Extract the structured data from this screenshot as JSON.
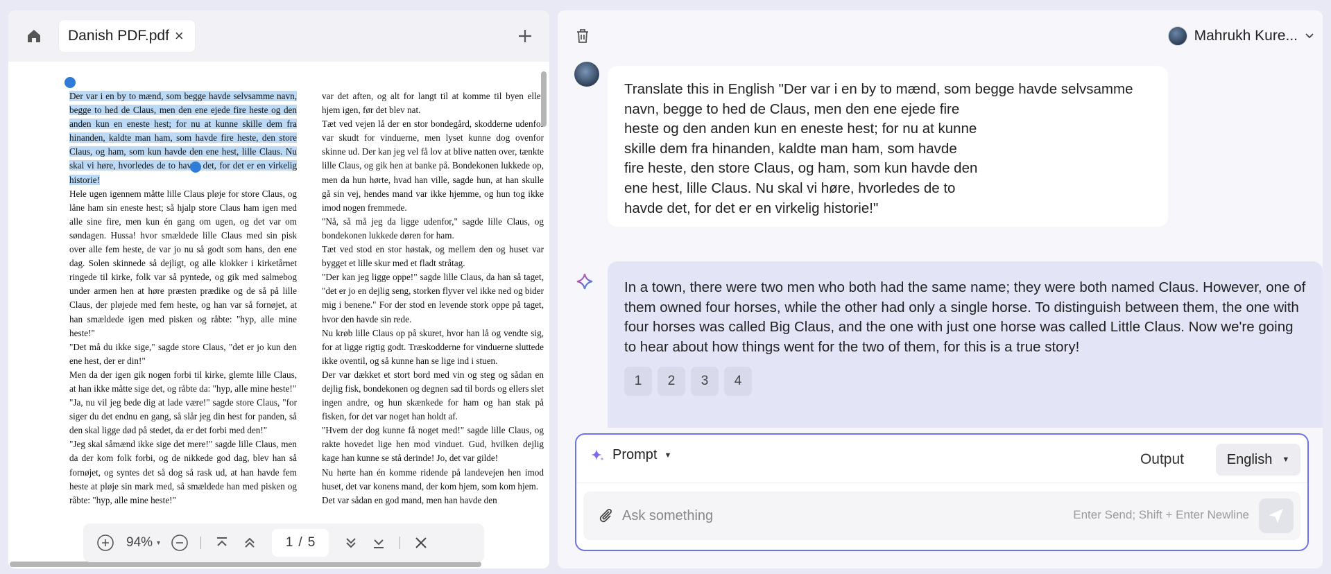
{
  "left_pane": {
    "tab": {
      "label": "Danish PDF.pdf",
      "close_glyph": "×"
    },
    "icons": {
      "home": "home-icon",
      "add": "plus-icon"
    },
    "pdf": {
      "left_column": [
        {
          "text": "Der var i en by to mænd, som begge havde selvsamme navn, begge to hed de Claus, men den ene ejede fire heste og den anden kun en eneste hest; for nu at kunne skille dem fra hinanden, kaldte man ham, som havde fire heste, den store Claus, og ham, som kun havde den ene hest, lille Claus. Nu skal vi høre, hvorledes de to havde det, for det er en virkelig historie!",
          "highlighted": true
        },
        {
          "text": "Hele ugen igennem måtte lille Claus pløje for store Claus, og låne ham sin eneste hest; så hjalp store Claus ham igen med alle sine fire, men kun én gang om ugen, og det var om søndagen. Hussa! hvor smældede lille Claus med sin pisk over alle fem heste, de var jo nu så godt som hans, den ene dag. Solen skinnede så dejligt, og alle klokker i kirketårnet ringede til kirke, folk var så pyntede, og gik med salmebog under armen hen at høre præsten prædike og de så på lille Claus, der pløjede med fem heste, og han var så fornøjet, at han smældede igen med pisken og råbte: \"hyp, alle mine heste!\"",
          "highlighted": false
        },
        {
          "text": "\"Det må du ikke sige,\" sagde store Claus, \"det er jo kun den ene hest, der er din!\"",
          "highlighted": false
        },
        {
          "text": "Men da der igen gik nogen forbi til kirke, glemte lille Claus, at han ikke måtte sige det, og råbte da: \"hyp, alle mine heste!\"",
          "highlighted": false
        },
        {
          "text": "\"Ja, nu vil jeg bede dig at lade være!\" sagde store Claus, \"for siger du det endnu en gang, så slår jeg din hest for panden, så den skal ligge død på stedet, da er det forbi med den!\"",
          "highlighted": false
        },
        {
          "text": "\"Jeg skal såmænd ikke sige det mere!\" sagde lille Claus, men da der kom folk forbi, og de nikkede god dag, blev han så fornøjet, og syntes det så dog så rask ud, at han havde fem heste at pløje sin mark med, så smældede han med pisken og råbte: \"hyp, alle mine heste!\"",
          "highlighted": false
        }
      ],
      "right_column": [
        "var det aften, og alt for langt til at komme til byen eller hjem igen, før det blev nat.",
        "Tæt ved vejen lå der en stor bondegård, skodderne udenfor var skudt for vinduerne, men lyset kunne dog ovenfor skinne ud. Der kan jeg vel få lov at blive natten over, tænkte lille Claus, og gik hen at banke på. Bondekonen lukkede op, men da hun hørte, hvad han ville, sagde hun, at han skulle gå sin vej, hendes mand var ikke hjemme, og hun tog ikke imod nogen fremmede.",
        "\"Nå, så må jeg da ligge udenfor,\" sagde lille Claus, og bondekonen lukkede døren for ham.",
        "Tæt ved stod en stor høstak, og mellem den og huset var bygget et lille skur med et fladt stråtag.",
        "\"Der kan jeg ligge oppe!\" sagde lille Claus, da han så taget, \"det er jo en dejlig seng, storken flyver vel ikke ned og bider mig i benene.\" For der stod en levende stork oppe på taget, hvor den havde sin rede.",
        "Nu krøb lille Claus op på skuret, hvor han lå og vendte sig, for at ligge rigtig godt. Træskodderne for vinduerne sluttede ikke oventil, og så kunne han se lige ind i stuen.",
        "Der var dækket et stort bord med vin og steg og sådan en dejlig fisk, bondekonen og degnen sad til bords og ellers slet ingen andre, og hun skænkede for ham og han stak på fisken, for det var noget han holdt af.",
        "\"Hvem der dog kunne få noget med!\" sagde lille Claus, og rakte hovedet lige hen mod vinduet. Gud, hvilken dejlig kage han kunne se stå derinde! Jo, det var gilde!",
        "Nu hørte han én komme ridende på landevejen hen imod huset, det var konens mand, der kom hjem, som kom hjem.",
        "Det var sådan en god mand, men han havde den"
      ]
    },
    "toolbar": {
      "zoom": "94%",
      "page_current": "1",
      "page_sep": "/",
      "page_total": "5",
      "icons": [
        "zoom-in-icon",
        "zoom-out-icon",
        "first-page-icon",
        "previous-page-icon",
        "next-page-icon",
        "last-page-icon",
        "close-icon"
      ]
    }
  },
  "right_pane": {
    "user": {
      "name": "Mahrukh Kure...",
      "avatar": "avatar"
    },
    "icons": {
      "trash": "trash-icon",
      "ai": "ai-sparkle-icon"
    },
    "messages": {
      "user_text": "Translate this in English \"Der var i en by to mænd, som begge havde selvsamme\nnavn, begge to hed de Claus, men den ene ejede fire\nheste og den anden kun en eneste hest; for nu at kunne\nskille dem fra hinanden, kaldte man ham, som havde\nfire heste, den store Claus, og ham, som kun havde den\nene hest, lille Claus. Nu skal vi høre, hvorledes de to\nhavde det, for det er en virkelig historie!\"",
      "ai_text": "In a town, there were two men who both had the same name; they were both named Claus. However, one of them owned four horses, while the other had only a single horse. To distinguish between them, the one with four horses was called Big Claus, and the one with just one horse was called Little Claus. Now we're going to hear about how things went for the two of them, for this is a true story!",
      "refs": [
        "1",
        "2",
        "3",
        "4"
      ]
    },
    "composer": {
      "prompt_label": "Prompt",
      "output_label": "Output",
      "language": "English",
      "placeholder": "Ask something",
      "hint": "Enter Send; Shift + Enter Newline"
    },
    "colors": {
      "accent": "#6e73e6",
      "ai_bubble": "#e4e4f7",
      "highlight": "#bcdaf5"
    }
  }
}
